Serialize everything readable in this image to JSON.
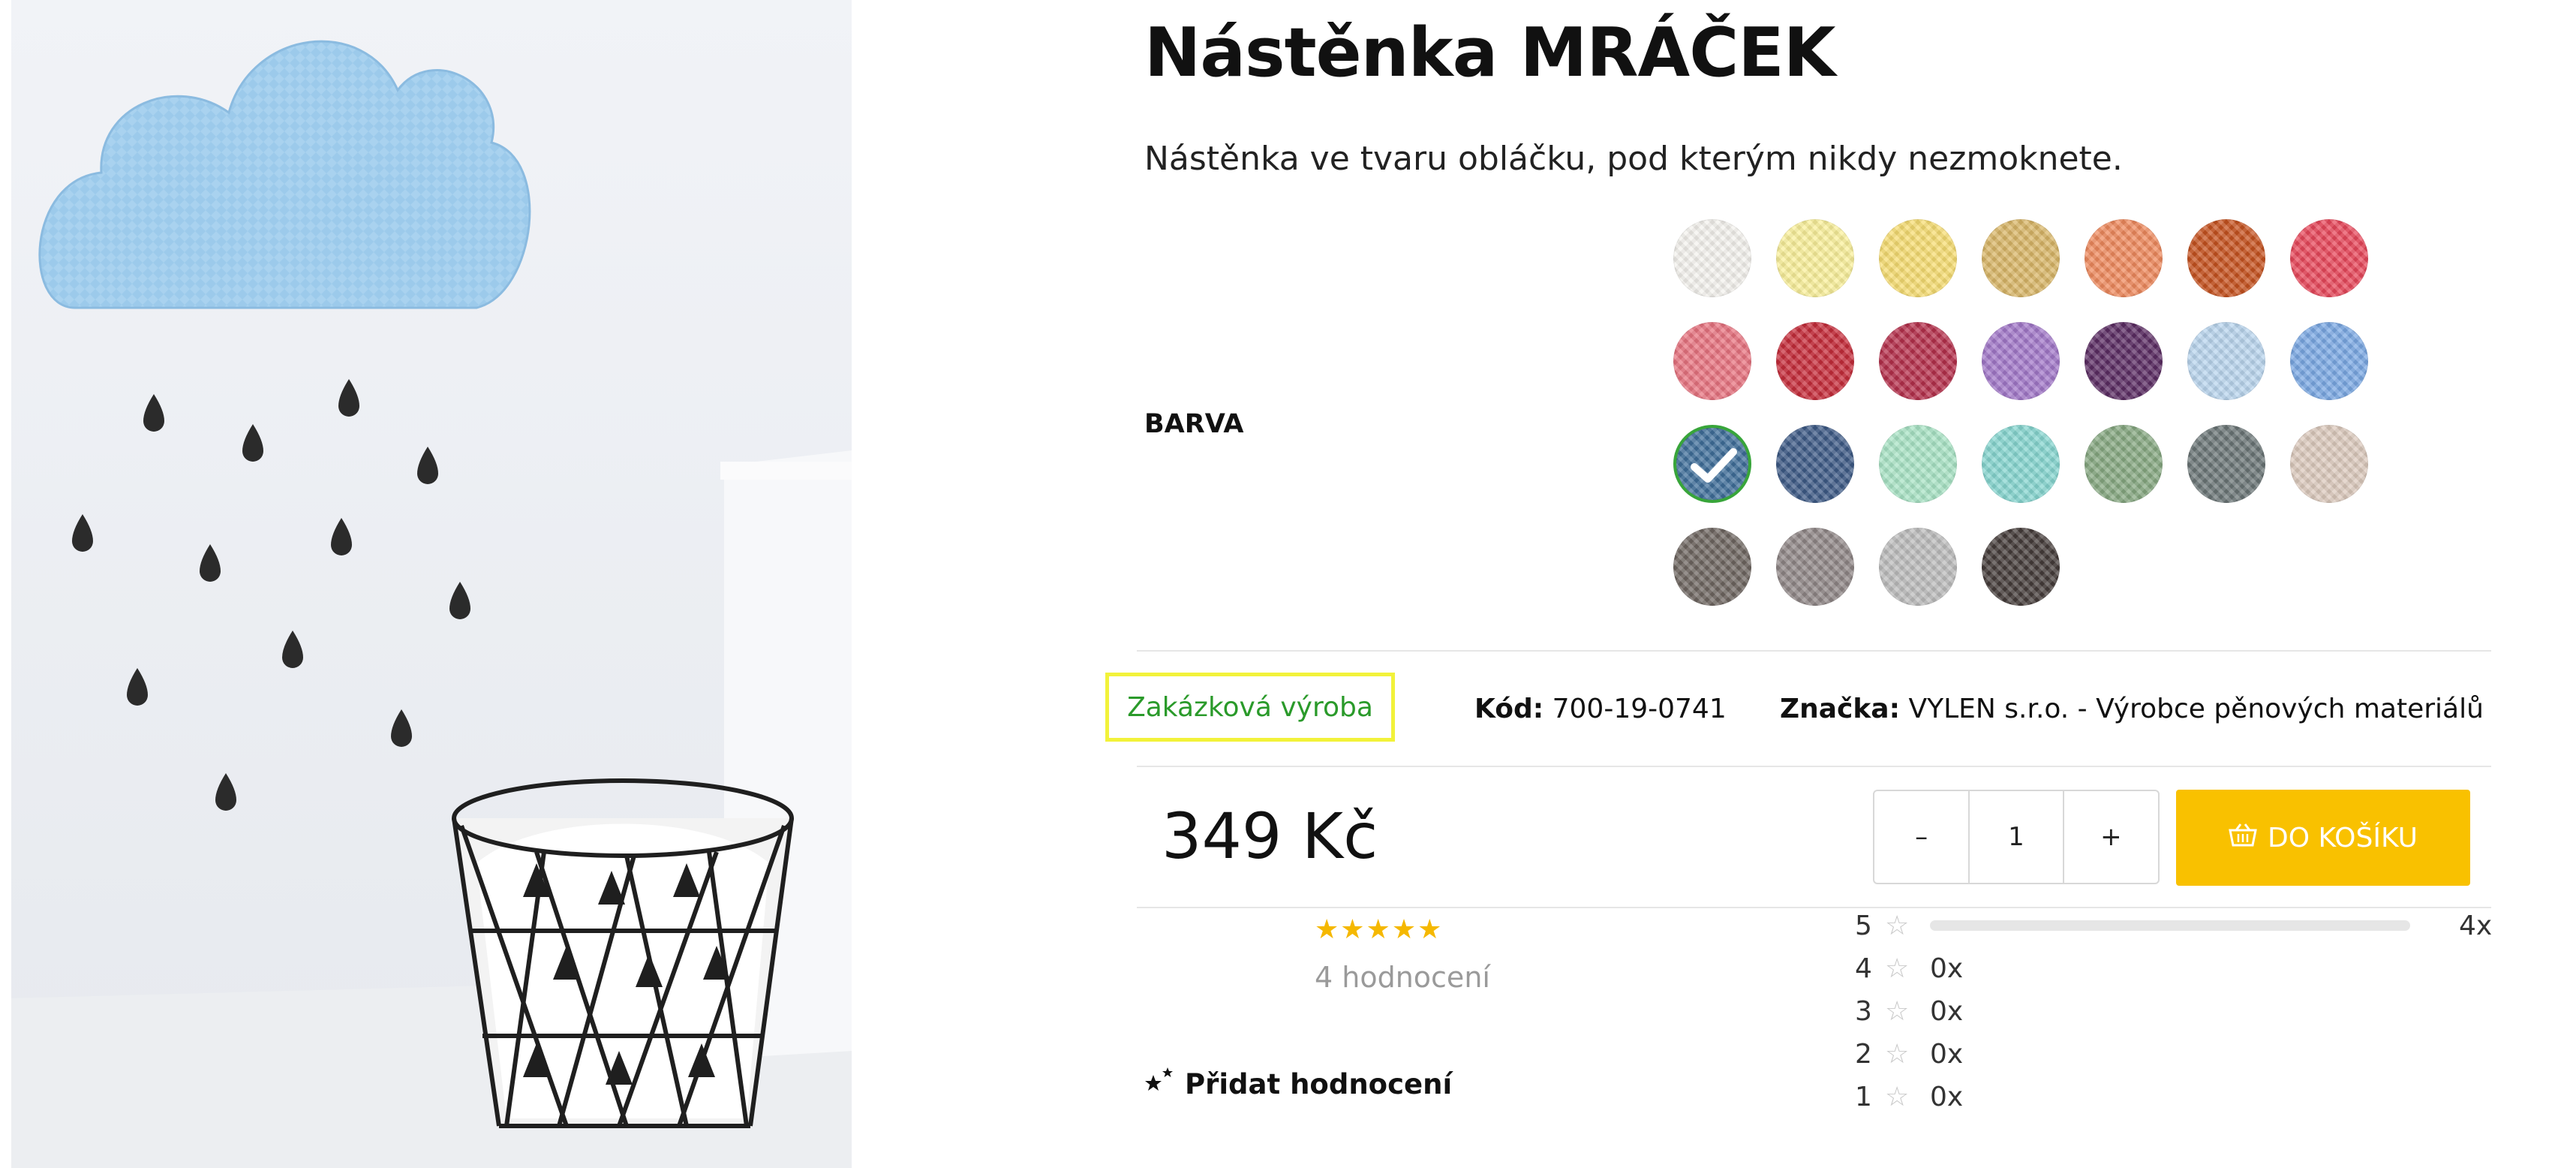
{
  "product": {
    "title": "Nástěnka MRÁČEK",
    "description": "Nástěnka ve tvaru obláčku, pod kterým nikdy nezmoknete."
  },
  "color_picker": {
    "label": "BARVA",
    "selected_index": 14,
    "swatches": [
      "#f4f2ee",
      "#faf09a",
      "#f7dd72",
      "#d9b667",
      "#ef8a5d",
      "#c6521f",
      "#e8475a",
      "#e8737f",
      "#c62c3a",
      "#b52f4b",
      "#a278c9",
      "#5b2c63",
      "#b9d5ee",
      "#7aa8e4",
      "#3f6e9a",
      "#3d5a86",
      "#a9e4c5",
      "#86d6d0",
      "#86a881",
      "#6a7576",
      "#dccabd",
      "#6e6661",
      "#8f8686",
      "#bcbcbc",
      "#453c3a"
    ]
  },
  "info": {
    "availability": "Zakázková výroba",
    "code_label": "Kód:",
    "code_value": "700-19-0741",
    "brand_label": "Značka:",
    "brand_value": "VYLEN s.r.o. - Výrobce pěnových materiálů"
  },
  "purchase": {
    "price": "349 Kč",
    "minus": "–",
    "quantity": "1",
    "plus": "+",
    "add_to_cart": "DO KOŠÍKU",
    "accent": "#f9c100"
  },
  "rating": {
    "stars": "★★★★★",
    "count_text": "4 hodnocení",
    "add_review": "Přidat hodnocení",
    "distribution": [
      {
        "stars": "5",
        "count": "4x",
        "fraction": 1.0
      },
      {
        "stars": "4",
        "count": "0x",
        "fraction": 0
      },
      {
        "stars": "3",
        "count": "0x",
        "fraction": 0
      },
      {
        "stars": "2",
        "count": "0x",
        "fraction": 0
      },
      {
        "stars": "1",
        "count": "0x",
        "fraction": 0
      }
    ]
  }
}
